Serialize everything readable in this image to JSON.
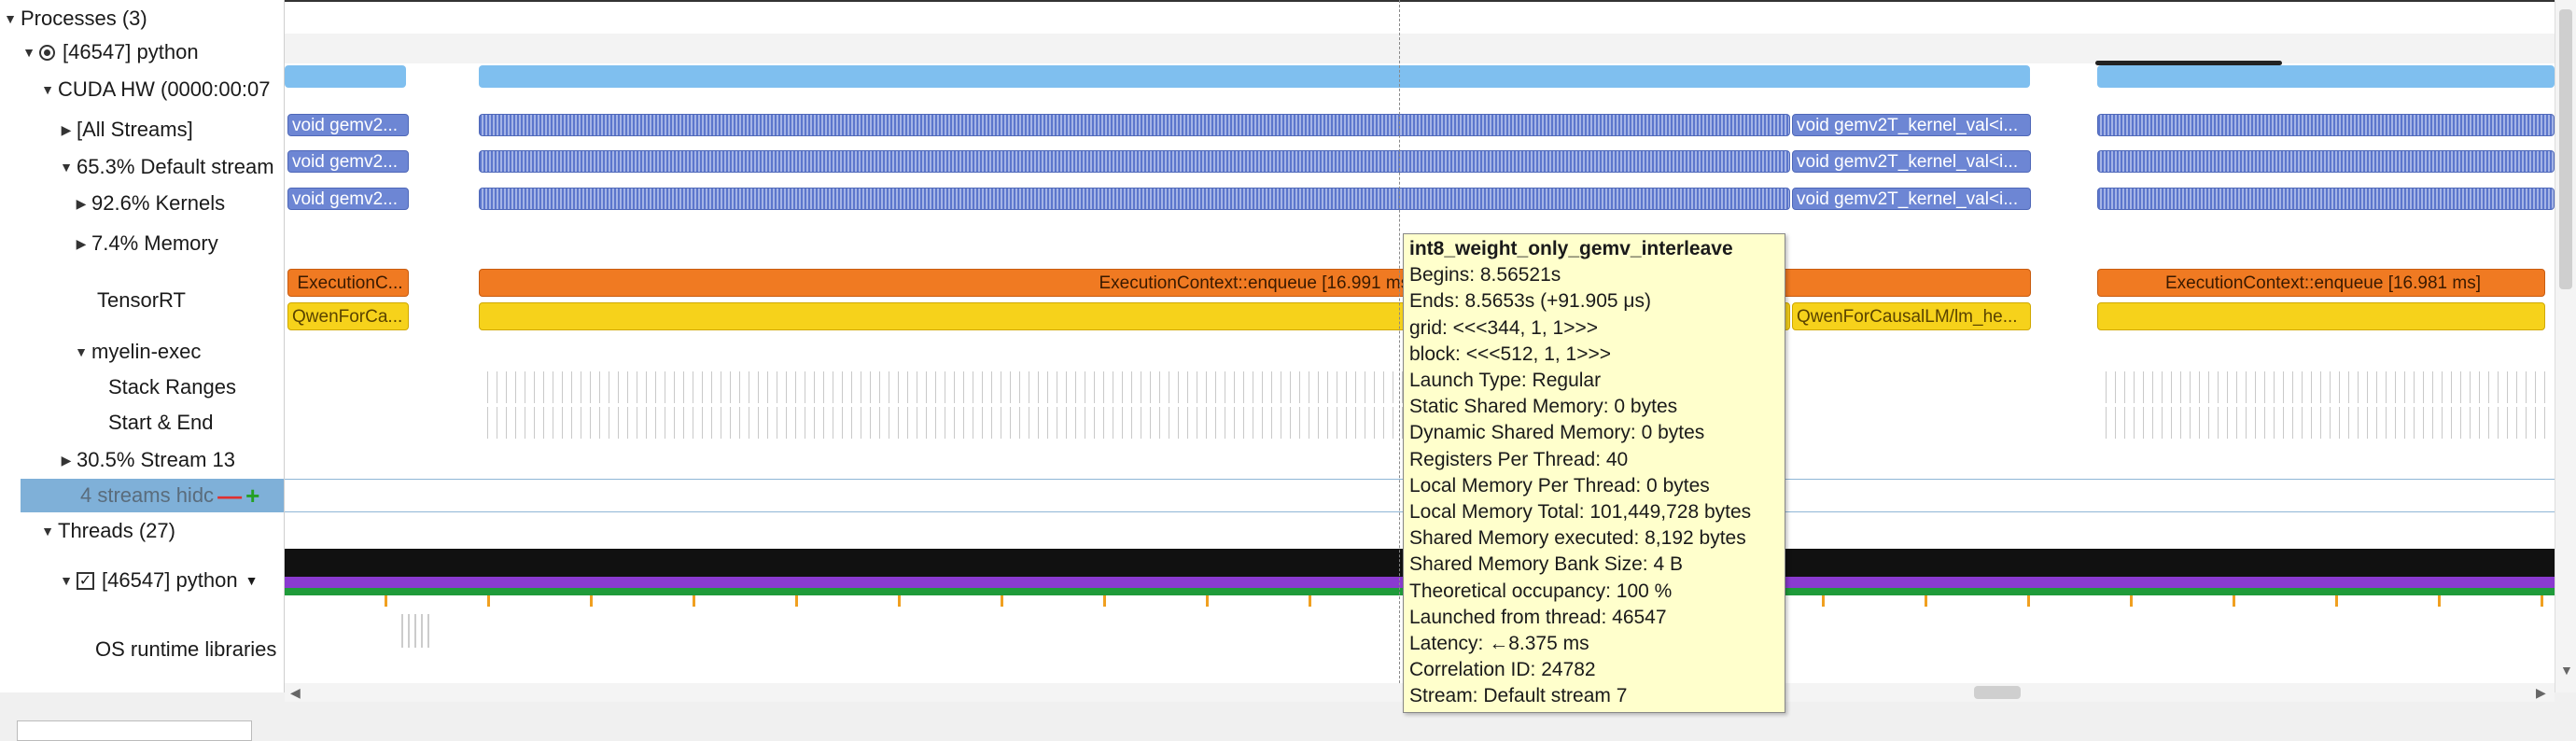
{
  "colors": {
    "kernel": "#6d86d4",
    "memory": "#7fbfef",
    "tensorrt_enqueue": "#f07a22",
    "tensorrt_model": "#f6d21b",
    "thread_black": "#111111",
    "thread_purple": "#8a3ad0",
    "thread_green": "#1f9b3a",
    "selection": "#7fb0d8",
    "tooltip_bg": "#ffffcc"
  },
  "tree": {
    "processes": "Processes (3)",
    "python_process": "[46547] python",
    "cuda_hw": "CUDA HW (0000:00:07",
    "all_streams": "[All Streams]",
    "default_stream": "65.3% Default stream",
    "kernels": "92.6% Kernels",
    "memory": "7.4% Memory",
    "tensorrt": "TensorRT",
    "myelin_exec": "myelin-exec",
    "stack_ranges": "Stack Ranges",
    "start_end": "Start & End",
    "stream13": "30.5% Stream 13",
    "hidden_streams": "4 streams hidc",
    "threads": "Threads (27)",
    "python_thread": "[46547] python",
    "os_runtime": "OS runtime libraries"
  },
  "timeline": {
    "all_streams_label_a": "void gemv2...",
    "all_streams_label_b": "void gemv2T_kernel_val<i...",
    "default_label_a": "void gemv2...",
    "default_label_b": "void gemv2T_kernel_val<i...",
    "kernels_label_a": "void gemv2...",
    "kernels_label_b": "void gemv2T_kernel_val<i...",
    "trt_enqueue_a": "ExecutionC...",
    "trt_enqueue_b": "ExecutionContext::enqueue [16.991 ms]",
    "trt_enqueue_c": "ExecutionContext::enqueue [16.981 ms]",
    "trt_model_a": "QwenForCa...",
    "trt_model_b": "QwenForCausalLM/lm_he..."
  },
  "tooltip": {
    "title": "int8_weight_only_gemv_interleave",
    "lines": [
      "Begins: 8.56521s",
      "Ends: 8.5653s (+91.905 μs)",
      "grid:  <<<344, 1, 1>>>",
      "block: <<<512, 1, 1>>>",
      "Launch Type: Regular",
      "Static Shared Memory: 0 bytes",
      "Dynamic Shared Memory: 0 bytes",
      "Registers Per Thread: 40",
      "Local Memory Per Thread: 0 bytes",
      "Local Memory Total: 101,449,728 bytes",
      "Shared Memory executed: 8,192 bytes",
      "Shared Memory Bank Size: 4 B",
      "Theoretical occupancy: 100 %",
      "Launched from thread: 46547",
      "Latency: ←8.375 ms",
      "Correlation ID: 24782",
      "Stream: Default stream 7"
    ]
  }
}
